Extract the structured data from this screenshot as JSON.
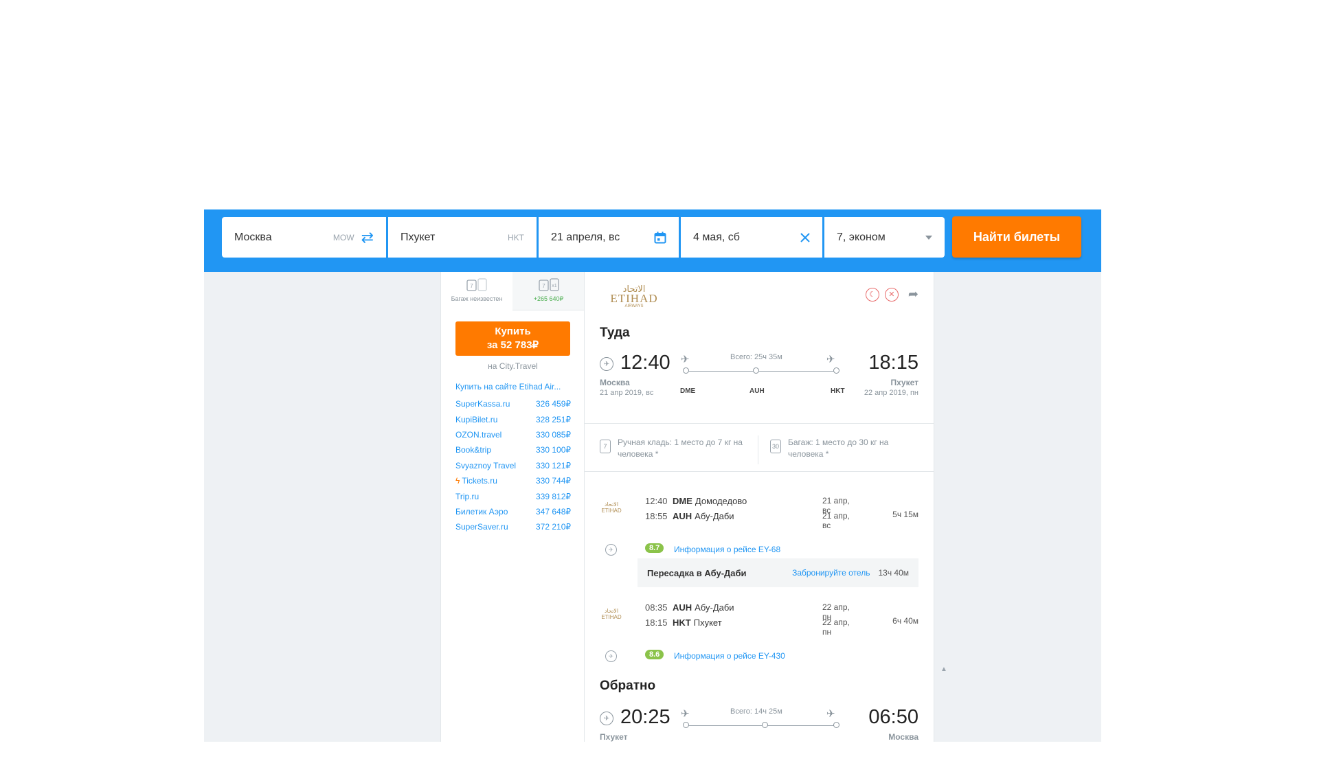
{
  "search": {
    "from_city": "Москва",
    "from_code": "MOW",
    "to_city": "Пхукет",
    "to_code": "HKT",
    "depart_date": "21 апреля, вс",
    "return_date": "4 мая, сб",
    "passengers": "7, эконом",
    "search_label": "Найти билеты"
  },
  "offer": {
    "tabs": [
      {
        "label": "Багаж неизвестен"
      },
      {
        "label": "+265 640₽"
      }
    ],
    "buy_line1": "Купить",
    "buy_line2": "за 52 783₽",
    "buy_via": "на City.Travel",
    "etihad_link": "Купить на сайте Etihad Air...",
    "agencies": [
      {
        "name": "SuperKassa.ru",
        "price": "326 459₽"
      },
      {
        "name": "KupiBilet.ru",
        "price": "328 251₽"
      },
      {
        "name": "OZON.travel",
        "price": "330 085₽"
      },
      {
        "name": "Book&trip",
        "price": "330 100₽"
      },
      {
        "name": "Svyaznoy Travel",
        "price": "330 121₽"
      },
      {
        "name": "Tickets.ru",
        "price": "330 744₽"
      },
      {
        "name": "Trip.ru",
        "price": "339 812₽"
      },
      {
        "name": "Билетик Аэро",
        "price": "347 648₽"
      },
      {
        "name": "SuperSaver.ru",
        "price": "372 210₽"
      }
    ]
  },
  "airline": {
    "logo_ar": "الاتحاد",
    "logo_en": "ETIHAD",
    "logo_sub": "AIRWAYS"
  },
  "outbound": {
    "title": "Туда",
    "dep_time": "12:40",
    "dep_city": "Москва",
    "dep_date": "21 апр 2019, вс",
    "arr_time": "18:15",
    "arr_city": "Пхукет",
    "arr_date": "22 апр 2019, пн",
    "total": "Всего: 25ч 35м",
    "airports": [
      "DME",
      "AUH",
      "HKT"
    ],
    "hand_luggage": "Ручная кладь: 1 место до 7 кг на человека *",
    "baggage": "Багаж: 1 место до 30 кг на человека *",
    "segments": [
      {
        "dep_time": "12:40",
        "dep_code": "DME",
        "dep_name": "Домодедово",
        "dep_date": "21 апр, вс",
        "arr_time": "18:55",
        "arr_code": "AUH",
        "arr_name": "Абу-Даби",
        "arr_date": "21 апр, вс",
        "duration": "5ч 15м",
        "rating": "8.7",
        "info": "Информация о рейсе EY-68"
      },
      {
        "dep_time": "08:35",
        "dep_code": "AUH",
        "dep_name": "Абу-Даби",
        "dep_date": "22 апр, пн",
        "arr_time": "18:15",
        "arr_code": "HKT",
        "arr_name": "Пхукет",
        "arr_date": "22 апр, пн",
        "duration": "6ч 40м",
        "rating": "8.6",
        "info": "Информация о рейсе EY-430"
      }
    ],
    "transfer": {
      "label": "Пересадка в Абу-Даби",
      "hotel": "Забронируйте отель",
      "duration": "13ч 40м"
    }
  },
  "return": {
    "title": "Обратно",
    "dep_time": "20:25",
    "dep_city": "Пхукет",
    "arr_time": "06:50",
    "arr_city": "Москва",
    "total": "Всего: 14ч 25м"
  },
  "colors": {
    "brand_blue": "#2196f3",
    "accent_orange": "#ff7a00",
    "rating_green": "#8bc34a",
    "airline_gold": "#b08d52"
  }
}
